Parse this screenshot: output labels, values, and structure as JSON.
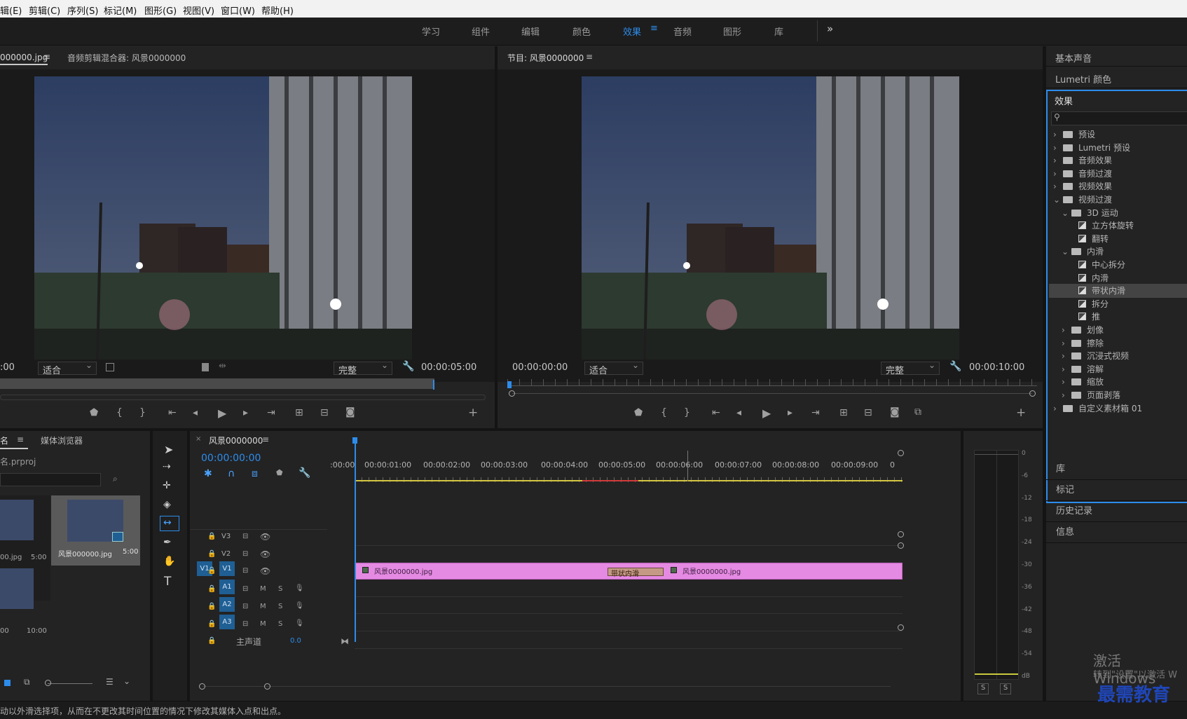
{
  "menubar": [
    "辑(E)",
    "剪辑(C)",
    "序列(S)",
    "标记(M)",
    "图形(G)",
    "视图(V)",
    "窗口(W)",
    "帮助(H)"
  ],
  "workspaces": [
    "学习",
    "组件",
    "编辑",
    "颜色",
    "效果",
    "音频",
    "图形",
    "库"
  ],
  "workspace_active": "效果",
  "workspace_more": "»",
  "source": {
    "tab": "000000.jpg",
    "tab2": "音频剪辑混合器: 风景0000000",
    "timecode": ":00",
    "fit": "适合",
    "quality": "完整",
    "duration": "00:00:05:00"
  },
  "program": {
    "tab": "节目: 风景0000000",
    "timecode": "00:00:00:00",
    "fit": "适合",
    "quality": "完整",
    "duration": "00:00:10:00"
  },
  "right": {
    "basic_sound": "基本声音",
    "lumetri": "Lumetri 颜色",
    "effects_title": "效果",
    "tree": [
      {
        "t": "预设",
        "lvl": 0,
        "kind": "bin",
        "open": false
      },
      {
        "t": "Lumetri 预设",
        "lvl": 0,
        "kind": "bin",
        "open": false
      },
      {
        "t": "音频效果",
        "lvl": 0,
        "kind": "folder",
        "open": false
      },
      {
        "t": "音频过渡",
        "lvl": 0,
        "kind": "folder",
        "open": false
      },
      {
        "t": "视频效果",
        "lvl": 0,
        "kind": "folder",
        "open": false
      },
      {
        "t": "视频过渡",
        "lvl": 0,
        "kind": "folder",
        "open": true
      },
      {
        "t": "3D 运动",
        "lvl": 1,
        "kind": "folder",
        "open": true
      },
      {
        "t": "立方体旋转",
        "lvl": 2,
        "kind": "fx"
      },
      {
        "t": "翻转",
        "lvl": 2,
        "kind": "fx"
      },
      {
        "t": "内滑",
        "lvl": 1,
        "kind": "folder",
        "open": true
      },
      {
        "t": "中心拆分",
        "lvl": 2,
        "kind": "fx"
      },
      {
        "t": "内滑",
        "lvl": 2,
        "kind": "fx"
      },
      {
        "t": "带状内滑",
        "lvl": 2,
        "kind": "fx",
        "selected": true
      },
      {
        "t": "拆分",
        "lvl": 2,
        "kind": "fx"
      },
      {
        "t": "推",
        "lvl": 2,
        "kind": "fx"
      },
      {
        "t": "划像",
        "lvl": 1,
        "kind": "folder",
        "open": false
      },
      {
        "t": "擦除",
        "lvl": 1,
        "kind": "folder",
        "open": false
      },
      {
        "t": "沉浸式视频",
        "lvl": 1,
        "kind": "folder",
        "open": false
      },
      {
        "t": "溶解",
        "lvl": 1,
        "kind": "folder",
        "open": false
      },
      {
        "t": "缩放",
        "lvl": 1,
        "kind": "folder",
        "open": false
      },
      {
        "t": "页面剥落",
        "lvl": 1,
        "kind": "folder",
        "open": false
      },
      {
        "t": "自定义素材箱 01",
        "lvl": 0,
        "kind": "folder",
        "open": false
      }
    ],
    "panels": [
      "库",
      "标记",
      "历史记录",
      "信息"
    ]
  },
  "project": {
    "tab": "名",
    "tab2": "媒体浏览器",
    "file": "名.prproj",
    "items": [
      {
        "name": "00.jpg",
        "dur": "5:00"
      },
      {
        "name": "风景000000.jpg",
        "dur": "5:00"
      },
      {
        "name": "00",
        "dur": "10:00"
      }
    ]
  },
  "timeline": {
    "tab": "风景0000000",
    "timecode": "00:00:00:00",
    "ruler": [
      ":00:00",
      "00:00:01:00",
      "00:00:02:00",
      "00:00:03:00",
      "00:00:04:00",
      "00:00:05:00",
      "00:00:06:00",
      "00:00:07:00",
      "00:00:08:00",
      "00:00:09:00",
      "0"
    ],
    "tracks": [
      "V3",
      "V2",
      "V1",
      "A1",
      "A2",
      "A3"
    ],
    "src_patch": "V1",
    "mix_label": "主声道",
    "mix_value": "0.0",
    "clip1": "风景0000000.jpg",
    "clip2": "风景0000000.jpg",
    "transition": "带状内滑"
  },
  "meter": {
    "scale": [
      "0",
      "-6",
      "-12",
      "-18",
      "-24",
      "-30",
      "-36",
      "-42",
      "-48",
      "-54",
      "dB"
    ],
    "solo": [
      "S",
      "S"
    ]
  },
  "status": "动以外滑选择项，从而在不更改其时间位置的情况下修改其媒体入点和出点。",
  "watermark": {
    "line1": "激活 Windows",
    "line2": "转到\"设置\"以激活 W",
    "logo": "最需教育"
  }
}
